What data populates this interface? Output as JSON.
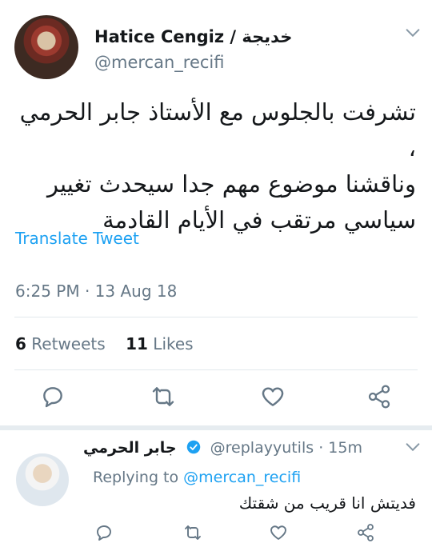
{
  "tweet": {
    "display_name": "Hatice Cengiz / خديجة",
    "handle": "@mercan_recifi",
    "text_lines": [
      "تشرفت بالجلوس مع الأستاذ جابر الحرمي ،",
      "وناقشنا موضوع مهم جدا سيحدث تغيير",
      "سياسي مرتقب في الأيام القادمة"
    ],
    "translate_label": "Translate Tweet",
    "timestamp": "6:25 PM · 13 Aug 18",
    "retweets_count": "6",
    "retweets_label": "Retweets",
    "likes_count": "11",
    "likes_label": "Likes",
    "icons": {
      "reply": "reply-icon",
      "retweet": "retweet-icon",
      "like": "heart-icon",
      "share": "share-icon",
      "more": "chevron-down-icon"
    }
  },
  "reply": {
    "display_name": "جابر الحرمي",
    "handle": "@replayyutils",
    "age": "15m",
    "replying_to_label": "Replying to",
    "replying_to_handle": "@mercan_recifi",
    "text": "فديتش انا قريب من شقتك"
  },
  "colors": {
    "accent": "#1da1f2",
    "muted": "#657786",
    "text": "#14171a",
    "divider": "#e1e8ed"
  }
}
